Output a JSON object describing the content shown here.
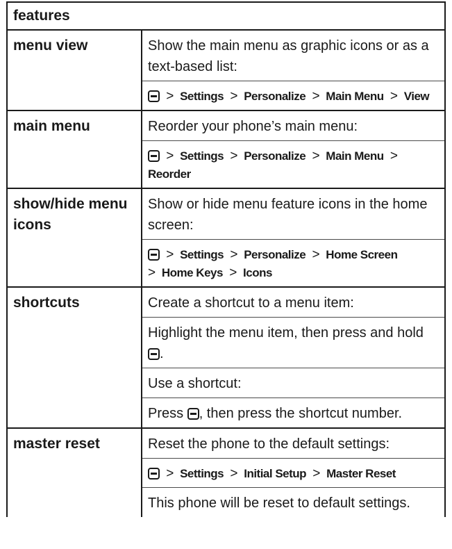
{
  "table": {
    "header": "features",
    "rows": [
      {
        "feature": "menu view",
        "description": "Show the main menu as graphic icons or as a text-based list:",
        "path": [
          "Settings",
          "Personalize",
          "Main Menu",
          "View"
        ]
      },
      {
        "feature": "main menu",
        "description": "Reorder your phone’s main menu:",
        "path": [
          "Settings",
          "Personalize",
          "Main Menu",
          "Reorder"
        ]
      },
      {
        "feature": "show/hide menu icons",
        "description": "Show or hide menu feature icons in the home screen:",
        "path": [
          "Settings",
          "Personalize",
          "Home Screen",
          "Home Keys",
          "Icons"
        ]
      },
      {
        "feature": "shortcuts",
        "description": "Create a shortcut to a menu item:",
        "step1_text": "Highlight the menu item, then press and hold",
        "step1_end": ".",
        "use_text": "Use a shortcut:",
        "press_text": "Press",
        "press_rest": ", then press the shortcut number."
      },
      {
        "feature": "master reset",
        "description": "Reset the phone to the default settings:",
        "path": [
          "Settings",
          "Initial Setup",
          "Master Reset"
        ],
        "note": "This phone will be reset to default settings."
      }
    ]
  },
  "icons": {
    "menu_key": "menu-key-icon"
  }
}
